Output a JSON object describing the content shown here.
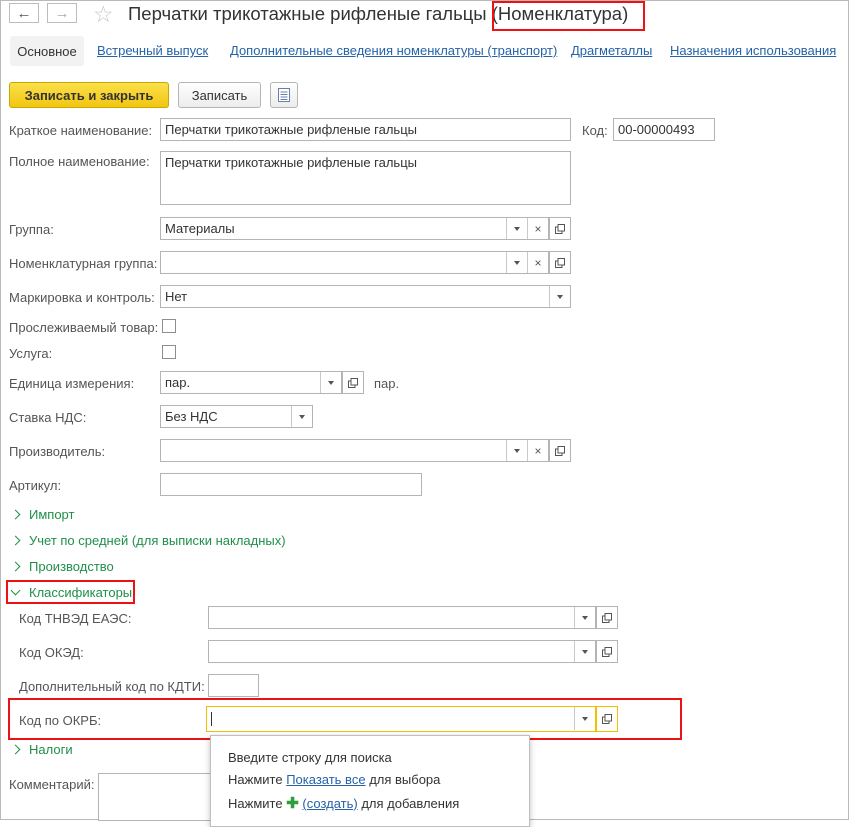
{
  "window": {
    "title": "Перчатки трикотажные рифленые гальцы",
    "title_suffix": "(Номенклатура)"
  },
  "tabs": [
    {
      "label": "Основное"
    },
    {
      "label": "Встречный выпуск"
    },
    {
      "label": "Дополнительные сведения номенклатуры (транспорт)"
    },
    {
      "label": "Драгметаллы"
    },
    {
      "label": "Назначения использования"
    }
  ],
  "toolbar": {
    "save_close_label": "Записать и закрыть",
    "save_label": "Записать"
  },
  "form": {
    "short_name_label": "Краткое наименование:",
    "short_name_value": "Перчатки трикотажные рифленые гальцы",
    "code_label": "Код:",
    "code_value": "00-00000493",
    "full_name_label": "Полное наименование:",
    "full_name_value": "Перчатки трикотажные рифленые гальцы",
    "group_label": "Группа:",
    "group_value": "Материалы",
    "nom_group_label": "Номенклатурная группа:",
    "nom_group_value": "",
    "marking_label": "Маркировка и контроль:",
    "marking_value": "Нет",
    "traceable_label": "Прослеживаемый товар:",
    "service_label": "Услуга:",
    "unit_label": "Единица измерения:",
    "unit_value": "пар.",
    "unit_suffix": "пар.",
    "vat_label": "Ставка НДС:",
    "vat_value": "Без НДС",
    "manufacturer_label": "Производитель:",
    "manufacturer_value": "",
    "article_label": "Артикул:",
    "article_value": ""
  },
  "groups": {
    "import": "Импорт",
    "avg": "Учет по средней (для выписки накладных)",
    "production": "Производство",
    "classifiers": "Классификаторы",
    "taxes": "Налоги"
  },
  "classifiers": {
    "tnved_label": "Код ТНВЭД ЕАЭС:",
    "tnved_value": "",
    "okved_label": "Код ОКЭД:",
    "okved_value": "",
    "kdti_label": "Дополнительный код по КДТИ:",
    "kdti_value": "",
    "okrb_label": "Код по ОКРБ:",
    "okrb_value": ""
  },
  "comment": {
    "label": "Комментарий:",
    "value": ""
  },
  "popup": {
    "line1": "Введите строку для поиска",
    "line2_prefix": "Нажмите",
    "line2_link": "Показать все",
    "line2_suffix": "для выбора",
    "line3_prefix": "Нажмите",
    "line3_link": "(создать)",
    "line3_suffix": "для добавления"
  },
  "colors": {
    "accent_yellow": "#f5cc1a",
    "link_blue": "#2563a8",
    "group_green": "#1f8f4a",
    "highlight_red": "#e11111"
  }
}
